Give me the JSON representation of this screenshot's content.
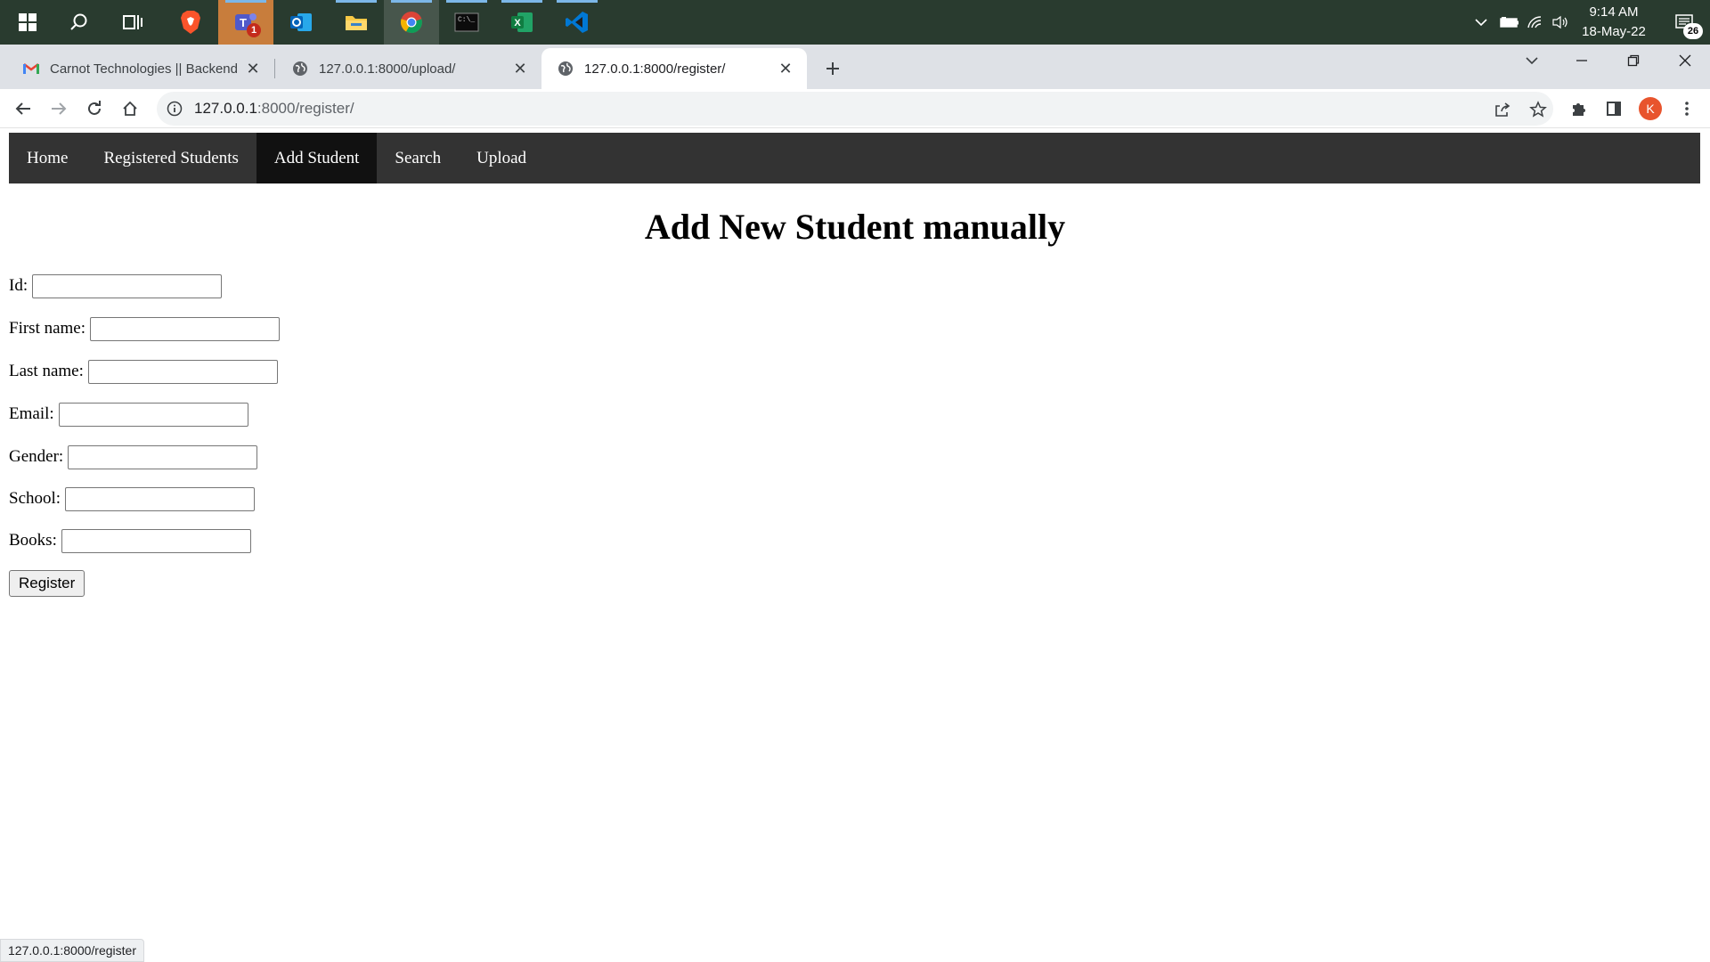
{
  "taskbar": {
    "apps": [
      {
        "name": "start",
        "icon": "windows-start-icon"
      },
      {
        "name": "search",
        "icon": "search-icon"
      },
      {
        "name": "task-view",
        "icon": "task-view-icon"
      },
      {
        "name": "brave",
        "icon": "brave-browser-icon"
      },
      {
        "name": "teams",
        "icon": "teams-icon",
        "badge": "1"
      },
      {
        "name": "outlook",
        "icon": "outlook-icon"
      },
      {
        "name": "file-explorer",
        "icon": "folder-icon"
      },
      {
        "name": "chrome",
        "icon": "chrome-icon"
      },
      {
        "name": "terminal",
        "icon": "terminal-icon"
      },
      {
        "name": "excel",
        "icon": "excel-icon"
      },
      {
        "name": "vscode",
        "icon": "vscode-icon"
      }
    ],
    "time": "9:14 AM",
    "date": "18-May-22",
    "notification_count": "26"
  },
  "browser": {
    "tabs": [
      {
        "title": "Carnot Technologies || Backend D",
        "icon": "gmail-icon"
      },
      {
        "title": "127.0.0.1:8000/upload/",
        "icon": "globe-icon"
      },
      {
        "title": "127.0.0.1:8000/register/",
        "icon": "globe-icon"
      }
    ],
    "url_host": "127.0.0.1",
    "url_rest": ":8000/register/",
    "profile_initial": "K",
    "status_url": "127.0.0.1:8000/register"
  },
  "page": {
    "nav": [
      "Home",
      "Registered Students",
      "Add Student",
      "Search",
      "Upload"
    ],
    "heading": "Add New Student manually",
    "fields": {
      "id": "Id:",
      "first_name": "First name:",
      "last_name": "Last name:",
      "email": "Email:",
      "gender": "Gender:",
      "school": "School:",
      "books": "Books:"
    },
    "submit": "Register"
  },
  "colors": {
    "taskbar": "#293b2f",
    "nav_bg": "#333333",
    "nav_active": "#111111",
    "avatar": "#e8542d"
  }
}
